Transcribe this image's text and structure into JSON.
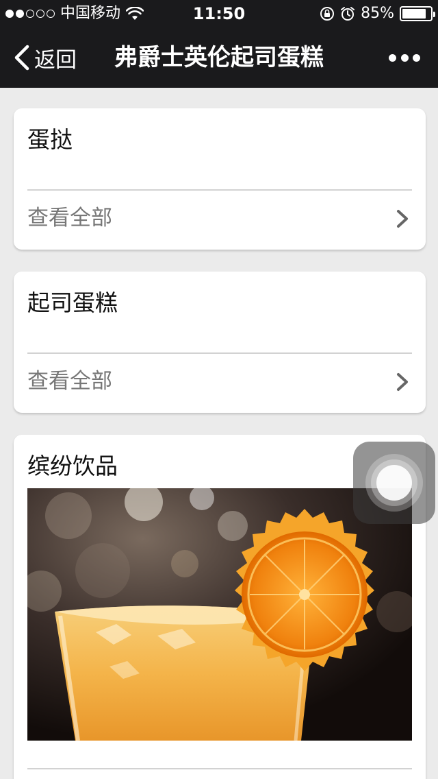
{
  "status_bar": {
    "carrier": "中国移动",
    "time": "11:50",
    "battery_percent": "85%",
    "battery_level": 0.85,
    "signal_bars_filled": 2,
    "signal_bars_total": 5,
    "icons": [
      "wifi-icon",
      "orientation-lock-icon",
      "alarm-icon",
      "battery-icon"
    ]
  },
  "nav": {
    "back_label": "返回",
    "title": "弗爵士英伦起司蛋糕",
    "more_icon": "more-dots-icon"
  },
  "categories": [
    {
      "title": "蛋挞",
      "action_label": "查看全部"
    },
    {
      "title": "起司蛋糕",
      "action_label": "查看全部"
    },
    {
      "title": "缤纷饮品",
      "image": "orange-juice-drink-photo"
    }
  ],
  "colors": {
    "bar_background": "#1a1a1c",
    "page_background": "#ebebeb",
    "card_background": "#ffffff",
    "secondary_text": "#777777"
  }
}
